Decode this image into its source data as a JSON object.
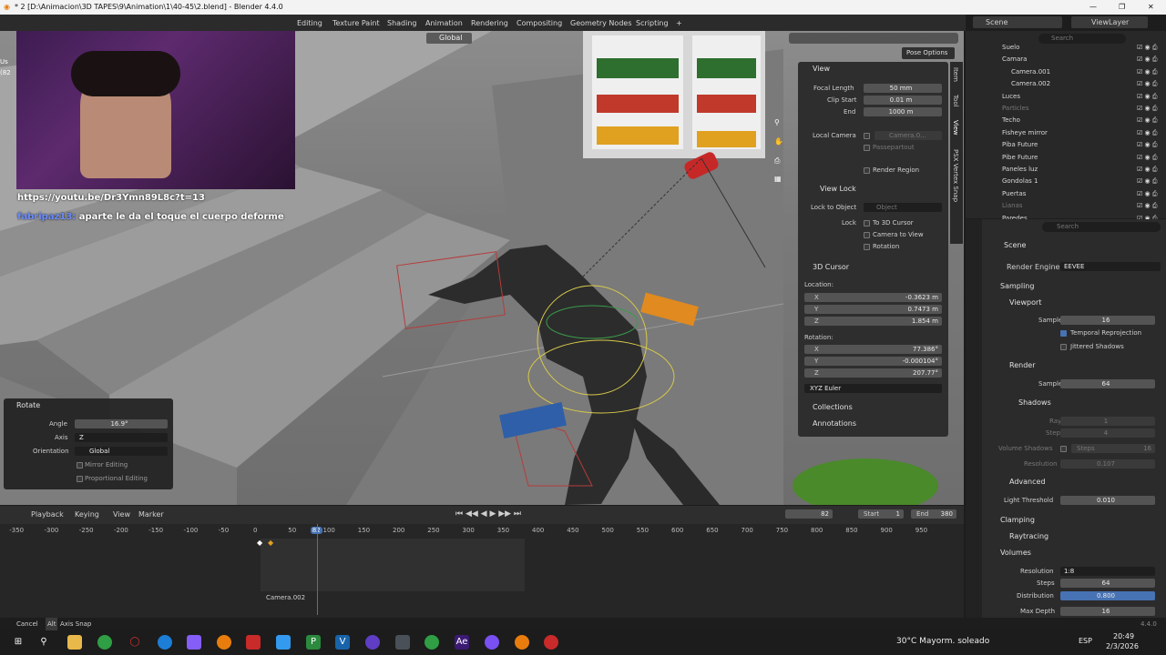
{
  "window": {
    "title": "* 2 [D:\\Animacion\\3D TAPES\\9\\Animation\\1\\40-45\\2.blend] - Blender 4.4.0"
  },
  "workspaces": [
    "Editing",
    "Texture Paint",
    "Shading",
    "Animation",
    "Rendering",
    "Compositing",
    "Geometry Nodes",
    "Scripting"
  ],
  "viewport_header": {
    "orientation": "Global",
    "pose_options": "Pose Options"
  },
  "overlay_labels": {
    "link": "https://youtu.be/Dr3Ymn89L8c?t=13",
    "chat_user": "fabripaz13:",
    "chat_msg": "aparte le da el toque el cuerpo deforme",
    "left_partial_1": "Us",
    "left_partial_2": "(82"
  },
  "npanel": {
    "tabs": [
      "Item",
      "Tool",
      "View",
      "PSX Vertex Snap"
    ],
    "view_header": "View",
    "focal_length_label": "Focal Length",
    "focal_length": "50 mm",
    "clip_start_label": "Clip Start",
    "clip_start": "0.01 m",
    "end_label": "End",
    "end": "1000 m",
    "local_camera_label": "Local Camera",
    "local_camera": "Camera.0...",
    "passepartout": "Passepartout",
    "render_region": "Render Region",
    "view_lock_header": "View Lock",
    "lock_to_object_label": "Lock to Object",
    "lock_to_object": "Object",
    "lock_label": "Lock",
    "to_3d_cursor": "To 3D Cursor",
    "camera_to_view": "Camera to View",
    "rotation_check": "Rotation",
    "cursor_header": "3D Cursor",
    "location_label": "Location:",
    "loc_x": "-0.3623 m",
    "loc_y": "0.7473 m",
    "loc_z": "1.854 m",
    "rotation_label": "Rotation:",
    "rot_x": "77.386°",
    "rot_y": "-0.000104°",
    "rot_z": "207.77°",
    "rot_mode": "XYZ Euler",
    "x": "X",
    "y": "Y",
    "z": "Z",
    "collections": "Collections",
    "annotations": "Annotations"
  },
  "rotate_panel": {
    "title": "Rotate",
    "angle_label": "Angle",
    "angle": "16.9°",
    "axis_label": "Axis",
    "axis": "Z",
    "orientation_label": "Orientation",
    "orientation": "Global",
    "mirror": "Mirror Editing",
    "proportional": "Proportional Editing"
  },
  "outliner": {
    "scene": "Scene",
    "viewlayer": "ViewLayer",
    "search": "Search",
    "rows": [
      {
        "name": "Suelo"
      },
      {
        "name": "Camara"
      },
      {
        "name": "Camera.001"
      },
      {
        "name": "Camera.002"
      },
      {
        "name": "Luces"
      },
      {
        "name": "Particles"
      },
      {
        "name": "Techo"
      },
      {
        "name": "Fisheye mirror"
      },
      {
        "name": "Piba Future"
      },
      {
        "name": "Pibe Future"
      },
      {
        "name": "Paneles luz"
      },
      {
        "name": "Gondolas 1"
      },
      {
        "name": "Puertas"
      },
      {
        "name": "Lianas"
      },
      {
        "name": "Paredes"
      }
    ]
  },
  "properties": {
    "search": "Search",
    "scene": "Scene",
    "render_engine_label": "Render Engine",
    "render_engine": "EEVEE",
    "sampling": "Sampling",
    "viewport": "Viewport",
    "samples_label": "Samples",
    "viewport_samples": "16",
    "temporal": "Temporal Reprojection",
    "jittered": "Jittered Shadows",
    "render": "Render",
    "render_samples": "64",
    "shadows": "Shadows",
    "rays_label": "Rays",
    "rays": "1",
    "steps_label": "Steps",
    "steps": "4",
    "volume_shadows_label": "Volume Shadows",
    "vs_steps_label": "Steps",
    "vs_steps": "16",
    "resolution_label": "Resolution",
    "resolution": "0.107",
    "advanced": "Advanced",
    "light_threshold_label": "Light Threshold",
    "light_threshold": "0.010",
    "clamping": "Clamping",
    "raytracing": "Raytracing",
    "volumes": "Volumes",
    "vol_resolution_label": "Resolution",
    "vol_resolution": "1:8",
    "vol_steps_label": "Steps",
    "vol_steps": "64",
    "distribution_label": "Distribution",
    "distribution": "0.800",
    "max_depth_label": "Max Depth",
    "max_depth": "16"
  },
  "timeline": {
    "menus": [
      "Playback",
      "Keying",
      "View",
      "Marker"
    ],
    "current_frame": "82",
    "start_label": "Start",
    "start": "1",
    "end_label": "End",
    "end": "380",
    "ticks": [
      "-350",
      "-300",
      "-250",
      "-200",
      "-150",
      "-100",
      "-50",
      "0",
      "50",
      "82",
      "100",
      "150",
      "200",
      "250",
      "300",
      "350",
      "400",
      "450",
      "500",
      "550",
      "600",
      "650",
      "700",
      "750",
      "800",
      "850",
      "900",
      "950"
    ],
    "camera_marker": "Camera.002"
  },
  "status": {
    "cancel": "Cancel",
    "alt": "Alt",
    "axis_snap": "Axis Snap",
    "version": "4.4.0"
  },
  "taskbar": {
    "weather": "30°C  Mayorm. soleado",
    "lang": "ESP",
    "time": "20:49",
    "date": "2/3/2026"
  }
}
